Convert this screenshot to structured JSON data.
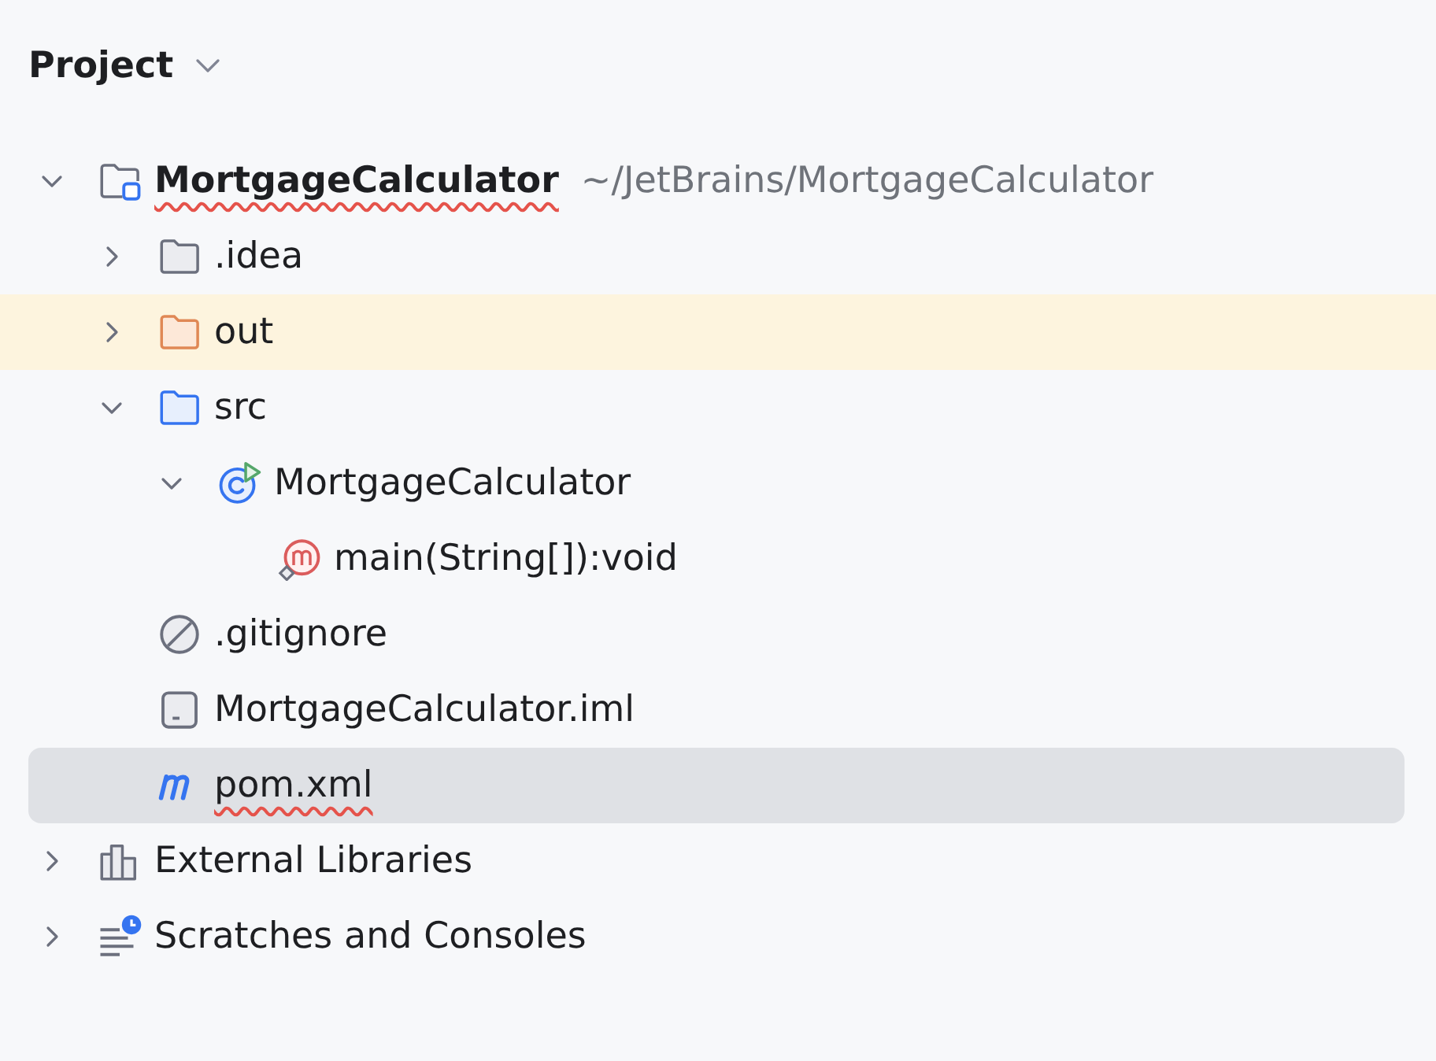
{
  "panel": {
    "title": "Project"
  },
  "tree": [
    {
      "label": "MortgageCalculator",
      "kind": "module",
      "path": "~/JetBrains/MortgageCalculator",
      "misspelled": true,
      "expanded": true,
      "selected": false,
      "highlighted": false,
      "children": [
        {
          "label": ".idea",
          "kind": "folder",
          "misspelled": false,
          "expanded": false,
          "selected": false,
          "highlighted": false
        },
        {
          "label": "out",
          "kind": "excluded_folder",
          "misspelled": false,
          "expanded": false,
          "selected": false,
          "highlighted": true
        },
        {
          "label": "src",
          "kind": "source_folder",
          "misspelled": false,
          "expanded": true,
          "selected": false,
          "highlighted": false,
          "children": [
            {
              "label": "MortgageCalculator",
              "kind": "class",
              "misspelled": false,
              "expanded": true,
              "selected": false,
              "highlighted": false,
              "children": [
                {
                  "label": "main(String[]):void",
                  "kind": "method",
                  "misspelled": false,
                  "selected": false,
                  "highlighted": false
                }
              ]
            }
          ]
        },
        {
          "label": ".gitignore",
          "kind": "ignore_file",
          "misspelled": false,
          "selected": false,
          "highlighted": false
        },
        {
          "label": "MortgageCalculator.iml",
          "kind": "module_file",
          "misspelled": false,
          "selected": false,
          "highlighted": false
        },
        {
          "label": "pom.xml",
          "kind": "maven_file",
          "misspelled": true,
          "selected": true,
          "highlighted": false
        }
      ]
    },
    {
      "label": "External Libraries",
      "kind": "libraries",
      "misspelled": false,
      "expanded": false,
      "selected": false,
      "highlighted": false
    },
    {
      "label": "Scratches and Consoles",
      "kind": "scratches",
      "misspelled": false,
      "expanded": false,
      "selected": false,
      "highlighted": false
    }
  ]
}
